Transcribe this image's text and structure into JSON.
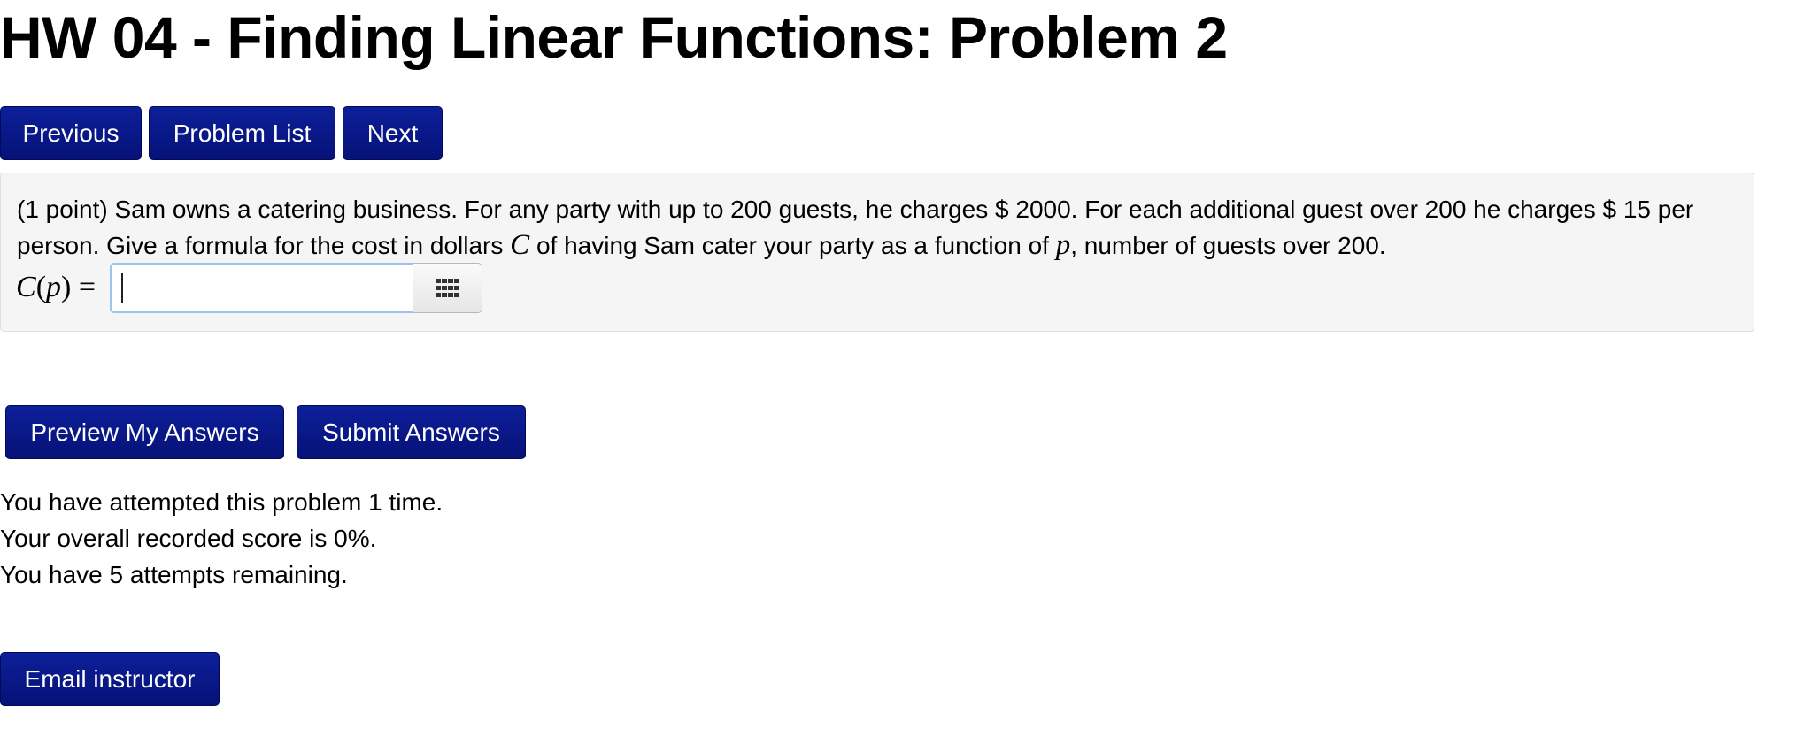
{
  "page": {
    "title": "HW 04 - Finding Linear Functions: Problem 2"
  },
  "nav": {
    "previous_label": "Previous",
    "problem_list_label": "Problem List",
    "next_label": "Next"
  },
  "problem": {
    "points": "(1 point)",
    "text_part1": "Sam owns a catering business. For any party with up to 200 guests, he charges $ 2000. For each additional guest over 200 he charges $ 15 per person. Give a formula for the cost in dollars",
    "var_C": "C",
    "text_part2": "of having Sam cater your party as a function of",
    "var_p": "p",
    "text_part3": ", number of guests over 200.",
    "answer": {
      "func_name": "C",
      "open_paren": "(",
      "arg": "p",
      "close_paren": ")",
      "equals": "=",
      "value": "",
      "palette_icon": "grid-icon"
    }
  },
  "actions": {
    "preview_label": "Preview My Answers",
    "submit_label": "Submit Answers"
  },
  "status": {
    "attempts_line": "You have attempted this problem 1 time.",
    "score_line": "Your overall recorded score is 0%.",
    "remaining_line": "You have 5 attempts remaining."
  },
  "contact": {
    "email_label": "Email instructor"
  },
  "colors": {
    "button_bg": "#061277",
    "panel_bg": "#f5f5f5",
    "input_focus_border": "#9ec3ef"
  }
}
